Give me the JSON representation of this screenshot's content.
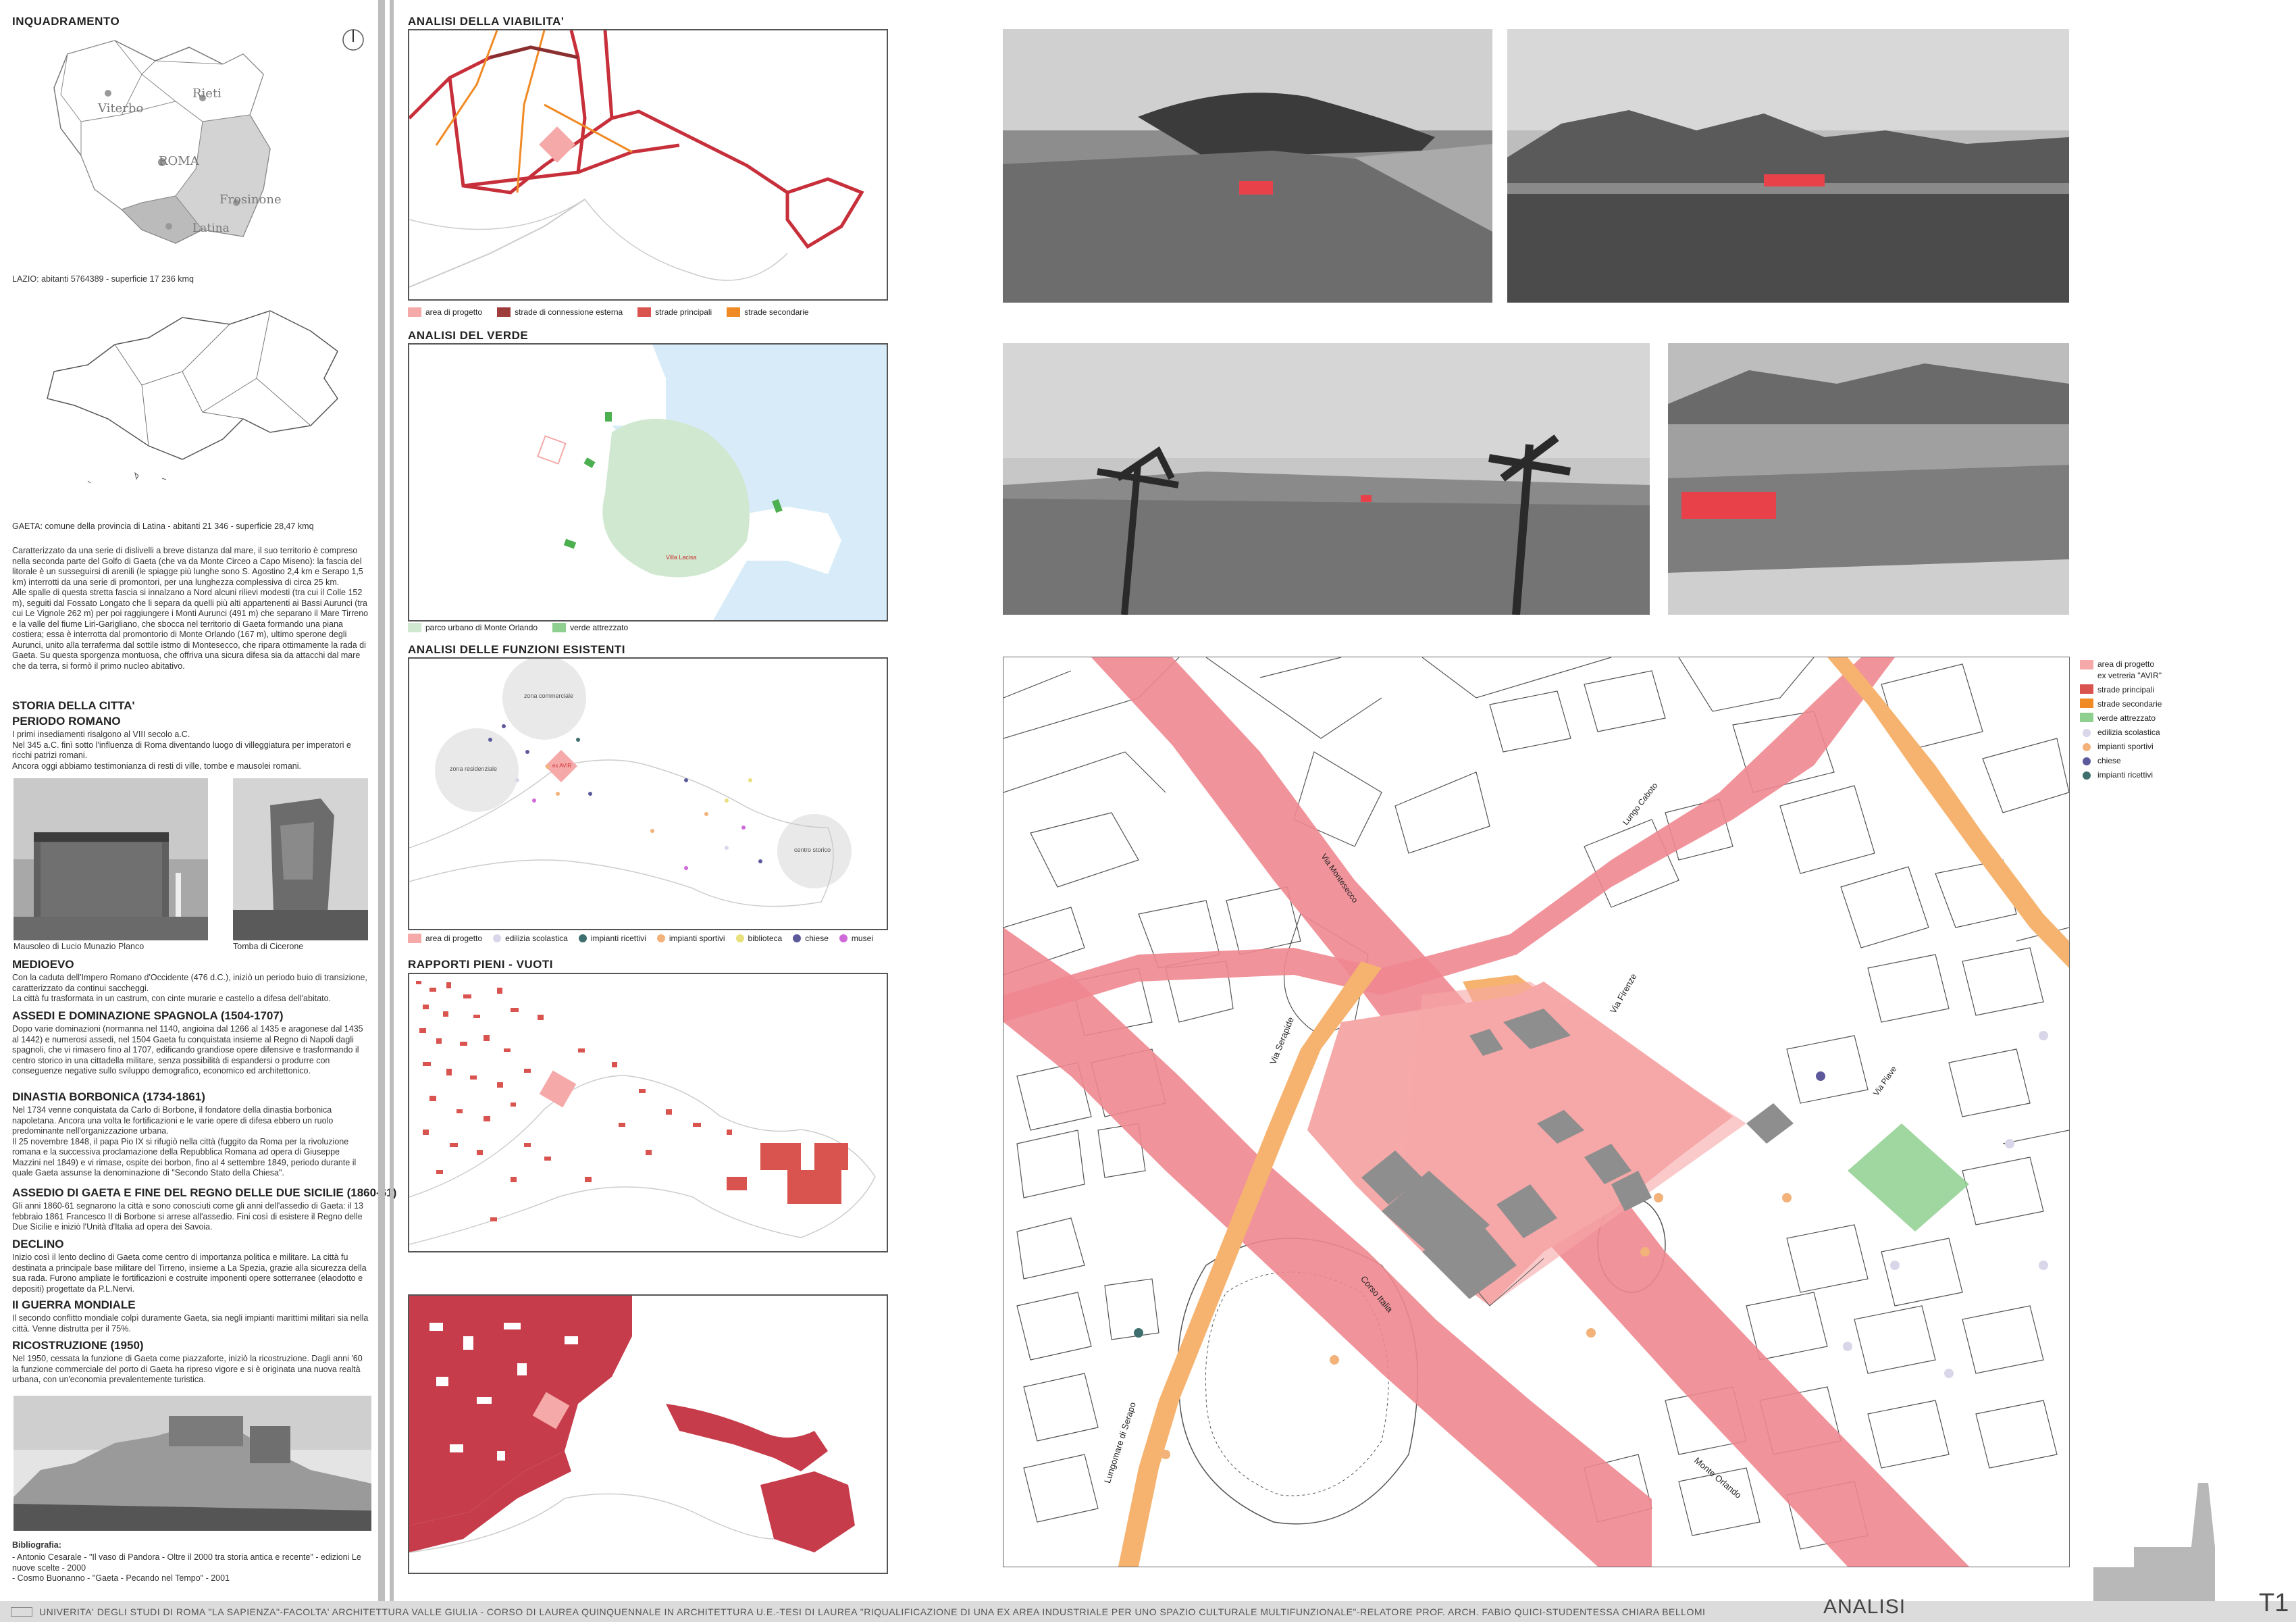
{
  "col1": {
    "title": "INQUADRAMENTO",
    "compass_label": "N",
    "lazio_map_labels": [
      "Viterbo",
      "Rieti",
      "ROMA",
      "Latina",
      "Frosinone"
    ],
    "lazio_caption": "LAZIO: abitanti 5764389 - superficie 17 236 kmq",
    "gaeta_caption": "GAETA: comune della provincia di Latina - abitanti 21 346 - superficie 28,47 kmq",
    "intro_text": "Caratterizzato da una serie di dislivelli a breve distanza dal mare, il suo territorio è compreso nella seconda parte del Golfo di Gaeta (che va da Monte Circeo a Capo Miseno): la fascia del litorale è un susseguirsi di arenili (le spiagge più lunghe sono S. Agostino 2,4 km e Serapo 1,5 km) interrotti da una serie di promontori, per una lunghezza complessiva di circa 25 km.\nAlle spalle di questa stretta fascia si innalzano a Nord alcuni rilievi modesti (tra cui il Colle 152 m), seguiti dal Fossato Longato che li separa da quelli più alti appartenenti ai Bassi Aurunci (tra cui Le Vignole 262 m) per poi raggiungere i Monti Aurunci (491 m) che separano il Mare Tirreno e la valle del fiume Liri-Garigliano, che sbocca nel territorio di Gaeta formando una piana costiera; essa è interrotta dal promontorio di Monte Orlando (167 m), ultimo sperone degli Aurunci, unito alla terraferma dal sottile istmo di Montesecco, che ripara ottimamente la rada di Gaeta. Su questa sporgenza montuosa, che offriva una sicura difesa sia da attacchi dal mare che da terra, si formò il primo nucleo abitativo.",
    "history_title": "STORIA DELLA CITTA'",
    "sections": [
      {
        "title": "PERIODO ROMANO",
        "text": "I primi insediamenti risalgono al VIII secolo a.C.\nNel 345 a.C. finì sotto l'influenza di Roma diventando luogo di villeggiatura per imperatori e ricchi patrizi romani.\nAncora oggi abbiamo testimonianza di resti di ville, tombe e mausolei romani."
      },
      {
        "title": "MEDIOEVO",
        "text": "Con la caduta dell'Impero Romano d'Occidente (476 d.C.), iniziò un periodo buio di transizione, caratterizzato da continui saccheggi.\nLa città fu trasformata in un castrum, con cinte murarie e castello a difesa dell'abitato."
      },
      {
        "title": "ASSEDI E DOMINAZIONE SPAGNOLA  (1504-1707)",
        "text": "Dopo varie dominazioni (normanna nel 1140, angioina dal 1266 al 1435 e aragonese dal 1435 al 1442) e numerosi assedi, nel 1504 Gaeta fu conquistata insieme al Regno di Napoli dagli spagnoli, che vi rimasero fino al 1707, edificando grandiose opere difensive e trasformando il centro storico in una cittadella militare, senza possibilità di espandersi o produrre con conseguenze negative sullo sviluppo demografico, economico ed architettonico."
      },
      {
        "title": "DINASTIA BORBONICA (1734-1861)",
        "text": "Nel 1734 venne conquistata da Carlo di Borbone, il fondatore della dinastia borbonica napoletana. Ancora una volta le fortificazioni e le varie opere di difesa ebbero un ruolo predominante nell'organizzazione urbana.\nIl 25 novembre 1848, il papa Pio IX si rifugiò nella città (fuggito da Roma per la rivoluzione romana e la successiva proclamazione della Repubblica Romana ad opera di Giuseppe Mazzini nel 1849) e vi rimase, ospite dei borbon, fino al 4 settembre 1849, periodo durante il quale Gaeta assunse la denominazione di \"Secondo Stato della Chiesa\"."
      },
      {
        "title": "ASSEDIO DI GAETA E FINE DEL REGNO DELLE DUE SICILIE (1860-61)",
        "text": "Gli anni 1860-61 segnarono la città e sono conosciuti come gli anni dell'assedio di Gaeta: il 13 febbraio 1861 Francesco II di Borbone si arrese all'assedio. Fini così di esistere il Regno delle Due Sicilie e iniziò l'Unità d'Italia ad opera dei Savoia."
      },
      {
        "title": "DECLINO",
        "text": "Inizio così il lento declino di Gaeta come centro di importanza politica e militare. La città fu destinata a principale base militare del Tirreno, insieme a La Spezia, grazie alla sicurezza della sua rada. Furono ampliate le fortificazioni e costruite imponenti opere sotterranee (elaodotto e depositi) progettate da P.L.Nervi."
      },
      {
        "title": "II GUERRA MONDIALE",
        "text": "Il secondo conflitto mondiale colpì duramente Gaeta, sia negli impianti marittimi militari sia nella città. Venne distrutta per il 75%."
      },
      {
        "title": "RICOSTRUZIONE (1950)",
        "text": "Nel 1950, cessata la funzione di Gaeta come piazzaforte, iniziò la ricostruzione. Dagli anni '60 la funzione commerciale del porto di Gaeta ha ripreso vigore e si è originata una nuova realtà urbana, con un'economia prevalentemente turistica."
      }
    ],
    "photo_captions": [
      "Mausoleo di Lucio Munazio Planco",
      "Tomba di Cicerone"
    ],
    "bibliography_title": "Bibliografia:",
    "bibliography": "- Antonio Cesarale - \"Il vaso di Pandora - Oltre il 2000 tra storia antica e recente\" - edizioni Le nuove scelte - 2000\n- Cosmo Buonanno - \"Gaeta - Pecando nel Tempo\" - 2001"
  },
  "col2": {
    "viabilita": {
      "title": "ANALISI DELLA VIABILITA'",
      "legend": [
        "area di progetto",
        "strade di connessione esterna",
        "strade principali",
        "strade secondarie"
      ]
    },
    "verde": {
      "title": "ANALISI DEL VERDE",
      "map_label": "Villa Lacisa",
      "legend": [
        "parco urbano di Monte Orlando",
        "verde attrezzato"
      ]
    },
    "funzioni": {
      "title": "ANALISI DELLE FUNZIONI ESISTENTI",
      "zones": [
        "zona commerciale",
        "zona residenziale",
        "centro storico"
      ],
      "project_label": "ex AVIR",
      "legend": [
        "area di progetto",
        "edilizia scolastica",
        "impianti ricettivi",
        "impianti sportivi",
        "biblioteca",
        "chiese",
        "musei"
      ]
    },
    "pieni_vuoti": {
      "title": "RAPPORTI PIENI - VUOTI"
    }
  },
  "plan": {
    "street_labels": [
      "Via Serapide",
      "Via Firenze",
      "Corso Italia",
      "Lungomare di Serapo",
      "Monte Orlando",
      "Lungo Caboto",
      "Via Montesecco",
      "Via Piave"
    ],
    "legend": [
      "area di progetto\nex vetreria \"AVIR\"",
      "strade principali",
      "strade secondarie",
      "verde attrezzato",
      "edilizia scolastica",
      "impianti sportivi",
      "chiese",
      "impianti ricettivi"
    ]
  },
  "colors": {
    "project": "#f6a9a9",
    "main_road": "#d9534f",
    "secondary_road": "#f0a14e",
    "external_road": "#9e3b3b",
    "green": "#8fcf8f",
    "school": "#d9d6ea",
    "sport": "#f2b27a",
    "church": "#5d5a9c",
    "hotel": "#3e6e6e",
    "library": "#e8e07a",
    "museum": "#cf6ad8"
  },
  "footer": {
    "text": "UNIVERITA' DEGLI STUDI DI ROMA \"LA SAPIENZA\"-FACOLTA' ARCHITETTURA VALLE GIULIA - CORSO DI LAUREA QUINQUENNALE IN ARCHITETTURA U.E.-TESI DI LAUREA \"RIQUALIFICAZIONE DI UNA EX AREA INDUSTRIALE PER UNO SPAZIO CULTURALE MULTIFUNZIONALE\"-RELATORE PROF. ARCH. FABIO QUICI-STUDENTESSA CHIARA BELLOMI",
    "section": "ANALISI",
    "sheet": "T1"
  }
}
